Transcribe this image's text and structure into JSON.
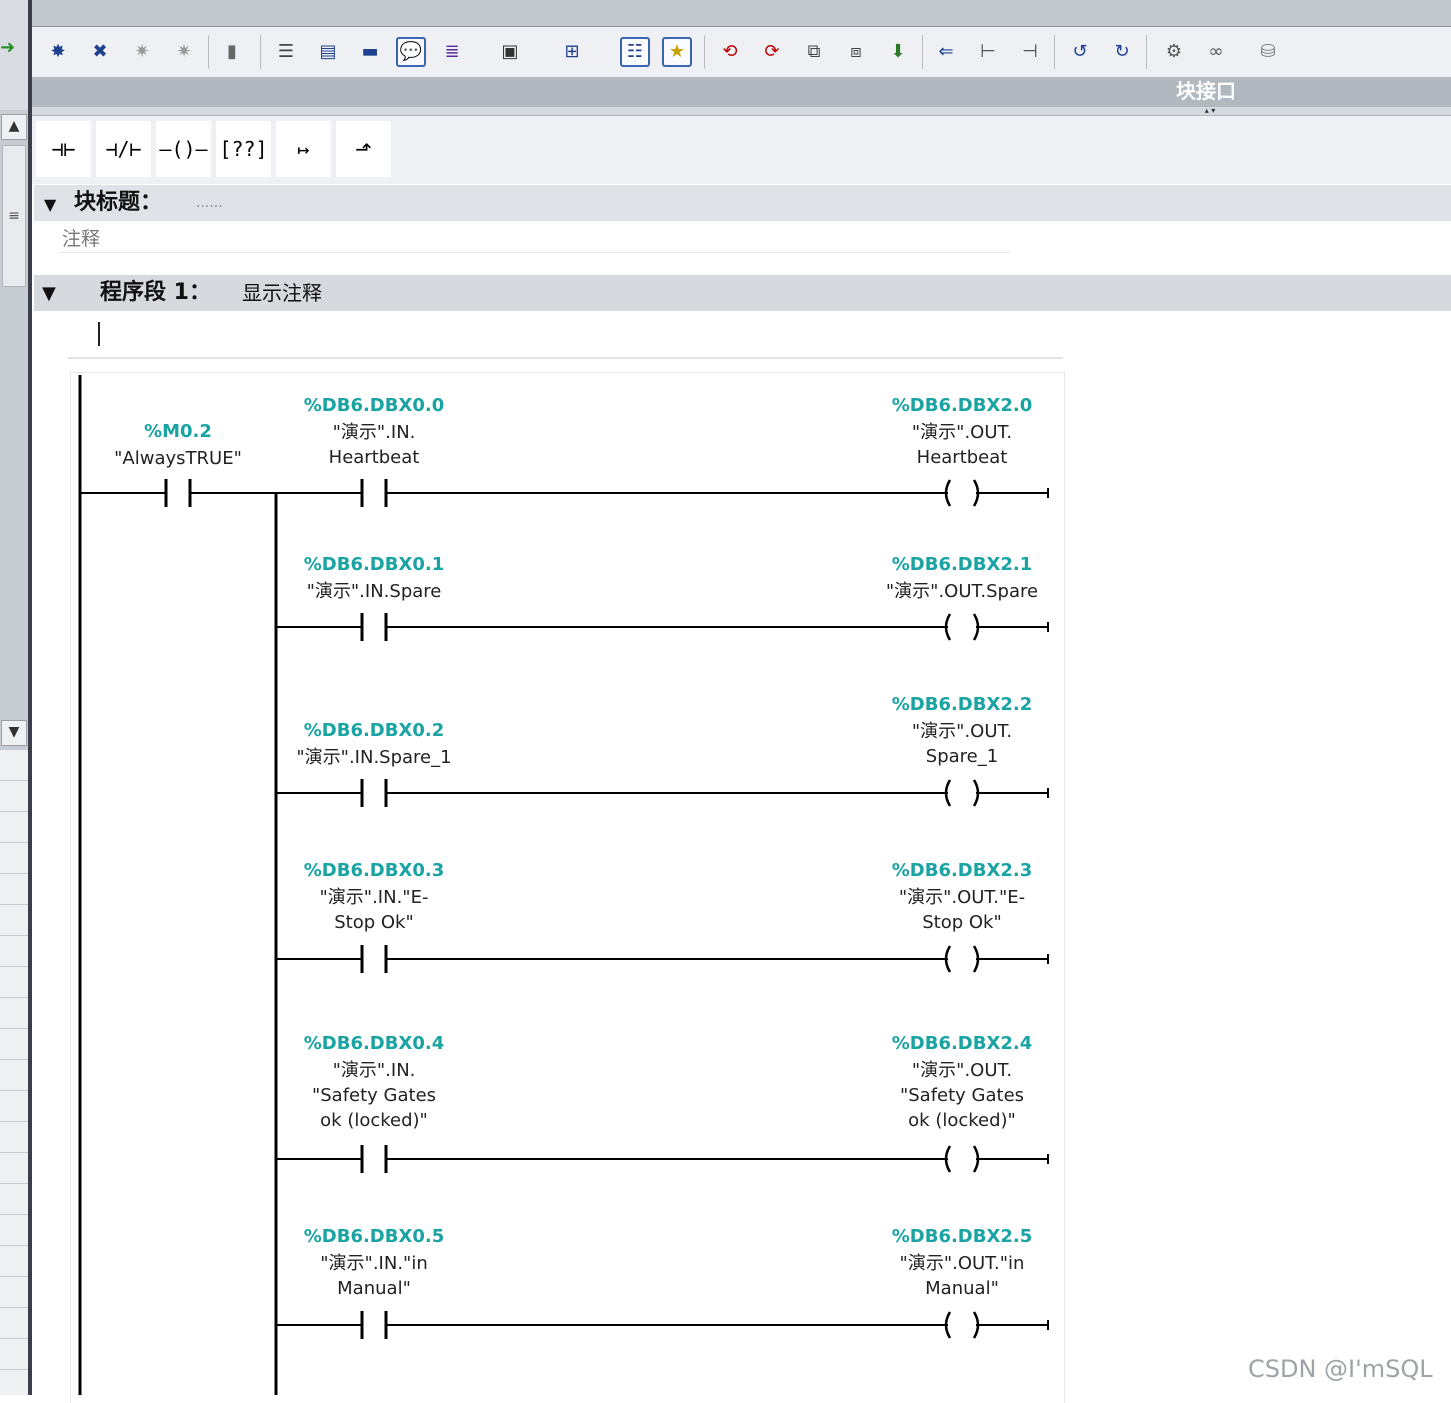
{
  "window": {
    "interface_label": "块接口"
  },
  "instructions": [
    {
      "name": "normally-open-contact",
      "glyph": "⊣⊢"
    },
    {
      "name": "normally-closed-contact",
      "glyph": "⊣/⊢"
    },
    {
      "name": "output-coil",
      "glyph": "–()–"
    },
    {
      "name": "empty-box",
      "glyph": "[??]"
    },
    {
      "name": "open-branch",
      "glyph": "↦"
    },
    {
      "name": "close-branch",
      "glyph": "⬏"
    }
  ],
  "block": {
    "title_label": "块标题：",
    "title_value": "......",
    "comment": "注释"
  },
  "network": {
    "label": "程序段 1：",
    "comment": "显示注释"
  },
  "rungs": [
    {
      "id": "rung-heartbeat",
      "contact": {
        "address": "%DB6.DBX0.0",
        "operand": "\"演示\".IN.\nHeartbeat"
      },
      "coil": {
        "address": "%DB6.DBX2.0",
        "operand": "\"演示\".OUT.\nHeartbeat"
      }
    },
    {
      "id": "rung-spare",
      "contact": {
        "address": "%DB6.DBX0.1",
        "operand": "\"演示\".IN.Spare"
      },
      "coil": {
        "address": "%DB6.DBX2.1",
        "operand": "\"演示\".OUT.Spare"
      }
    },
    {
      "id": "rung-spare1",
      "contact": {
        "address": "%DB6.DBX0.2",
        "operand": "\"演示\".IN.Spare_1"
      },
      "coil": {
        "address": "%DB6.DBX2.2",
        "operand": "\"演示\".OUT.\nSpare_1"
      }
    },
    {
      "id": "rung-estop",
      "contact": {
        "address": "%DB6.DBX0.3",
        "operand": "\"演示\".IN.\"E-\nStop Ok\""
      },
      "coil": {
        "address": "%DB6.DBX2.3",
        "operand": "\"演示\".OUT.\"E-\nStop Ok\""
      }
    },
    {
      "id": "rung-safety",
      "contact": {
        "address": "%DB6.DBX0.4",
        "operand": "\"演示\".IN.\n\"Safety Gates\nok (locked)\""
      },
      "coil": {
        "address": "%DB6.DBX2.4",
        "operand": "\"演示\".OUT.\n\"Safety Gates\nok (locked)\""
      }
    },
    {
      "id": "rung-manual",
      "contact": {
        "address": "%DB6.DBX0.5",
        "operand": "\"演示\".IN.\"in\nManual\""
      },
      "coil": {
        "address": "%DB6.DBX2.5",
        "operand": "\"演示\".OUT.\"in\nManual\""
      }
    }
  ],
  "first_contact": {
    "address": "%M0.2",
    "operand": "\"AlwaysTRUE\""
  },
  "watermark": "CSDN @I'mSQL"
}
